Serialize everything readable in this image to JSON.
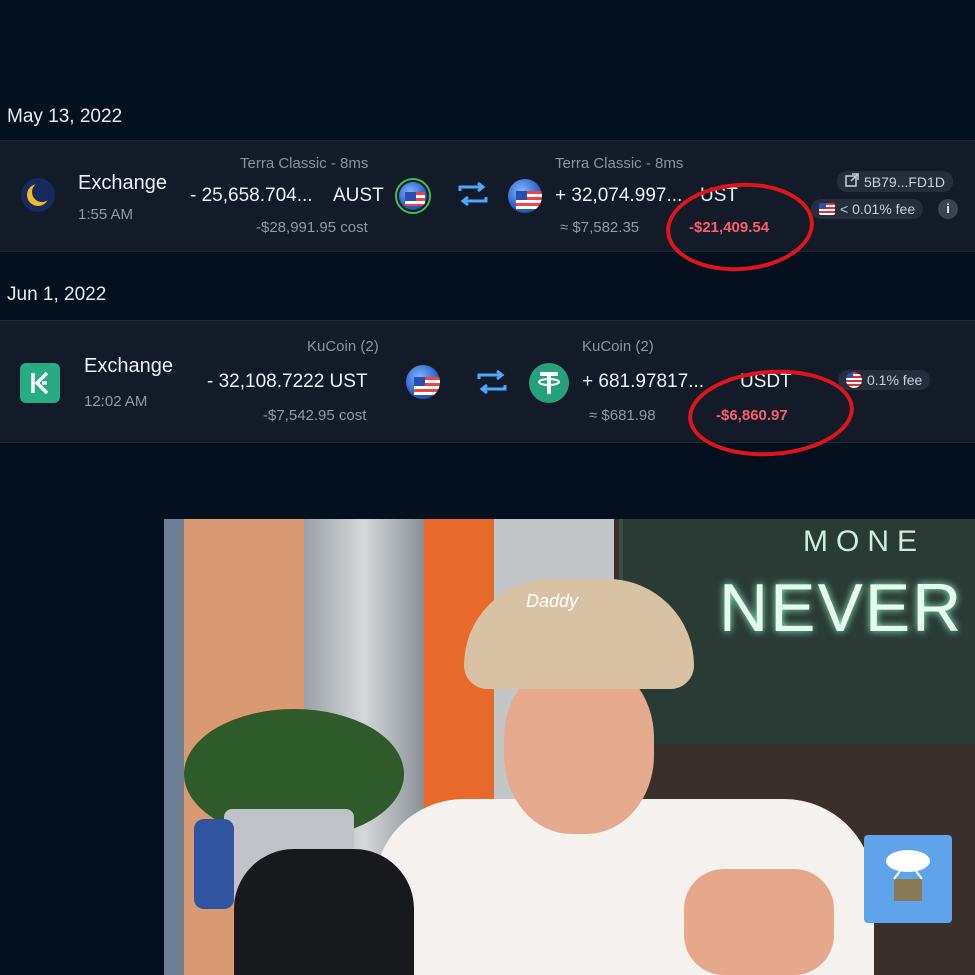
{
  "group1": {
    "date": "May 13, 2022",
    "type": "Exchange",
    "time": "1:55 AM",
    "from": {
      "venue": "Terra Classic - 8ms",
      "amount": "- 25,658.704...",
      "token": "AUST",
      "cost": "-$28,991.95 cost"
    },
    "to": {
      "venue": "Terra Classic - 8ms",
      "amount": "+ 32,074.997...",
      "token": "UST",
      "approx": "≈ $7,582.35",
      "loss": "-$21,409.54"
    },
    "tx": "5B79...FD1D",
    "fee": "< 0.01% fee",
    "info": "i"
  },
  "group2": {
    "date": "Jun 1, 2022",
    "type": "Exchange",
    "time": "12:02 AM",
    "from": {
      "venue": "KuCoin (2)",
      "amount": "- 32,108.7222 UST",
      "cost": "-$7,542.95 cost"
    },
    "to": {
      "venue": "KuCoin (2)",
      "amount": "+ 681.97817...",
      "token": "USDT",
      "approx": "≈ $681.98",
      "loss": "-$6,860.97"
    },
    "fee": "0.1% fee"
  },
  "icons": {
    "terra": "terra-luna-icon",
    "kucoin": "kucoin-logo-icon",
    "swap": "swap-arrows-icon",
    "tether": "tether-icon",
    "ust": "ust-flag-coin-icon",
    "link": "external-link-icon"
  },
  "colors": {
    "background": "#05101f",
    "row": "#131b28",
    "loss": "#ff5b6e",
    "swap": "#4ba8ff",
    "annotation": "#e1141c"
  },
  "video": {
    "cap_text": "Daddy",
    "sign_top": "MONE",
    "sign_main": "NEVER SL"
  }
}
